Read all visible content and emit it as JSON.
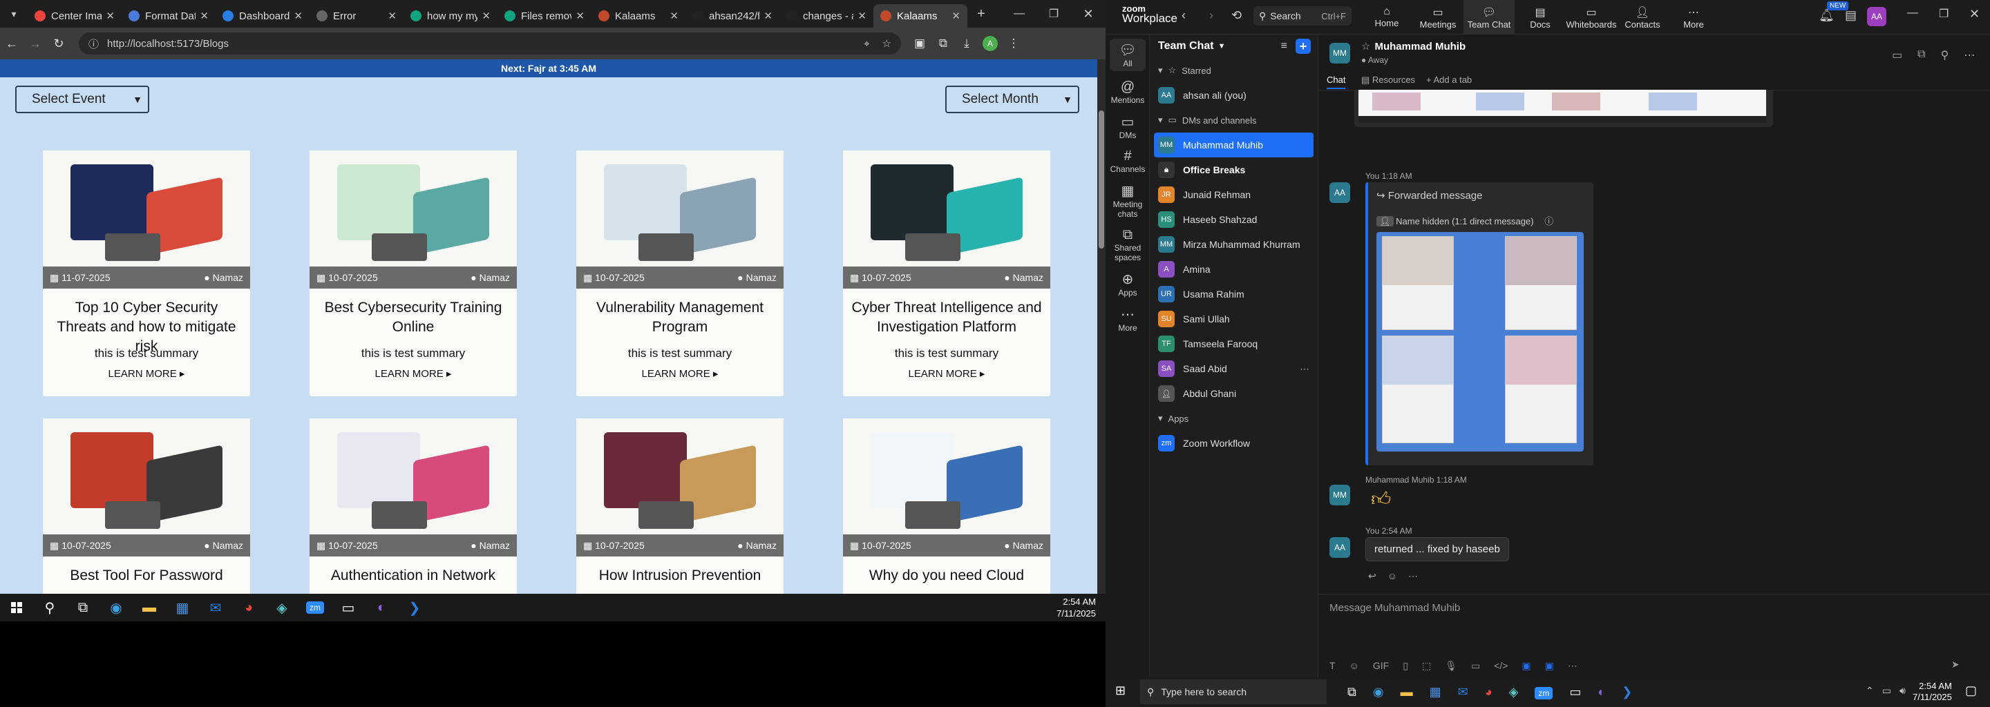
{
  "chrome": {
    "tabs": [
      {
        "title": "Center Imag",
        "color": "#e8453c"
      },
      {
        "title": "Format Dat",
        "color": "#4a7bd8"
      },
      {
        "title": "Dashboard",
        "color": "#2a7de1"
      },
      {
        "title": "Error",
        "color": "#666"
      },
      {
        "title": "how my my",
        "color": "#10a37f"
      },
      {
        "title": "Files remov",
        "color": "#10a37f"
      },
      {
        "title": "Kalaams",
        "color": "#c24a2a"
      },
      {
        "title": "ahsan242/f",
        "color": "#222"
      },
      {
        "title": "changes - a",
        "color": "#222"
      },
      {
        "title": "Kalaams",
        "color": "#c24a2a"
      }
    ],
    "url": "http://localhost:5173/Blogs",
    "avatar": "A"
  },
  "blog": {
    "topbar": "Next: Fajr at 3:45 AM",
    "select_event": "Select Event",
    "select_month": "Select Month",
    "cards": [
      {
        "date": "11-07-2025",
        "category": "Namaz",
        "title": "Top 10 Cyber Security Threats and how to mitigate risk",
        "summary": "this is test summary",
        "more": "LEARN MORE ▸"
      },
      {
        "date": "10-07-2025",
        "category": "Namaz",
        "title": "Best Cybersecurity Training Online",
        "summary": "this is test summary",
        "more": "LEARN MORE ▸"
      },
      {
        "date": "10-07-2025",
        "category": "Namaz",
        "title": "Vulnerability Management Program",
        "summary": "this is test summary",
        "more": "LEARN MORE ▸"
      },
      {
        "date": "10-07-2025",
        "category": "Namaz",
        "title": "Cyber Threat Intelligence and Investigation Platform",
        "summary": "this is test summary",
        "more": "LEARN MORE ▸"
      },
      {
        "date": "10-07-2025",
        "category": "Namaz",
        "title": "Best Tool For Password",
        "summary": "",
        "more": ""
      },
      {
        "date": "10-07-2025",
        "category": "Namaz",
        "title": "Authentication in Network",
        "summary": "",
        "more": ""
      },
      {
        "date": "10-07-2025",
        "category": "Namaz",
        "title": "How Intrusion Prevention",
        "summary": "",
        "more": ""
      },
      {
        "date": "10-07-2025",
        "category": "Namaz",
        "title": "Why do you need Cloud",
        "summary": "",
        "more": ""
      }
    ]
  },
  "taskbar_left": {
    "time": "2:54 AM",
    "date": "7/11/2025"
  },
  "zoom": {
    "brand_top": "zoom",
    "brand_bottom": "Workplace",
    "search": "Search",
    "search_shortcut": "Ctrl+F",
    "nav": [
      "Home",
      "Meetings",
      "Team Chat",
      "Docs",
      "Whiteboards",
      "Contacts",
      "More"
    ],
    "new_badge": "NEW",
    "user_initials": "AA",
    "rail": [
      "All",
      "Mentions",
      "DMs",
      "Channels",
      "Meeting chats",
      "Shared spaces",
      "Apps",
      "More"
    ],
    "list_title": "Team Chat",
    "starred": "Starred",
    "self": "ahsan ali (you)",
    "dms_header": "DMs and channels",
    "contacts": [
      {
        "initials": "MM",
        "name": "Muhammad Muhib",
        "color": "#2c7a8f",
        "active": true
      },
      {
        "initials": "",
        "name": "Office Breaks",
        "color": "#333",
        "bold": true
      },
      {
        "initials": "JR",
        "name": "Junaid Rehman",
        "color": "#e3832a"
      },
      {
        "initials": "HS",
        "name": "Haseeb Shahzad",
        "color": "#2a8f7a"
      },
      {
        "initials": "MM",
        "name": "Mirza Muhammad Khurram",
        "color": "#2c7a8f"
      },
      {
        "initials": "A",
        "name": "Amina",
        "color": "#8a4fc0"
      },
      {
        "initials": "UR",
        "name": "Usama Rahim",
        "color": "#2c6fb5"
      },
      {
        "initials": "SU",
        "name": "Sami Ullah",
        "color": "#e3832a"
      },
      {
        "initials": "TF",
        "name": "Tamseela Farooq",
        "color": "#2a8f6a"
      },
      {
        "initials": "SA",
        "name": "Saad Abid",
        "color": "#8a4fc0"
      },
      {
        "initials": "",
        "name": "Abdul Ghani",
        "color": "#555"
      }
    ],
    "apps_header": "Apps",
    "app": "Zoom Workflow",
    "chat_user": "Muhammad Muhib",
    "chat_status": "Away",
    "chat_tab": "Chat",
    "resources": "Resources",
    "add_tab": "Add a tab",
    "msg1_meta": "You 1:18 AM",
    "forwarded": "Forwarded message",
    "name_hidden": "Name hidden (1:1 direct message)",
    "msg2_meta": "Muhammad Muhib 1:18 AM",
    "msg3_meta": "You 2:54 AM",
    "msg3_text": "returned ... fixed by haseeb",
    "compose_placeholder": "Message Muhammad Muhib",
    "taskbar_search": "Type here to search",
    "time": "2:54 AM",
    "date": "7/11/2025"
  }
}
